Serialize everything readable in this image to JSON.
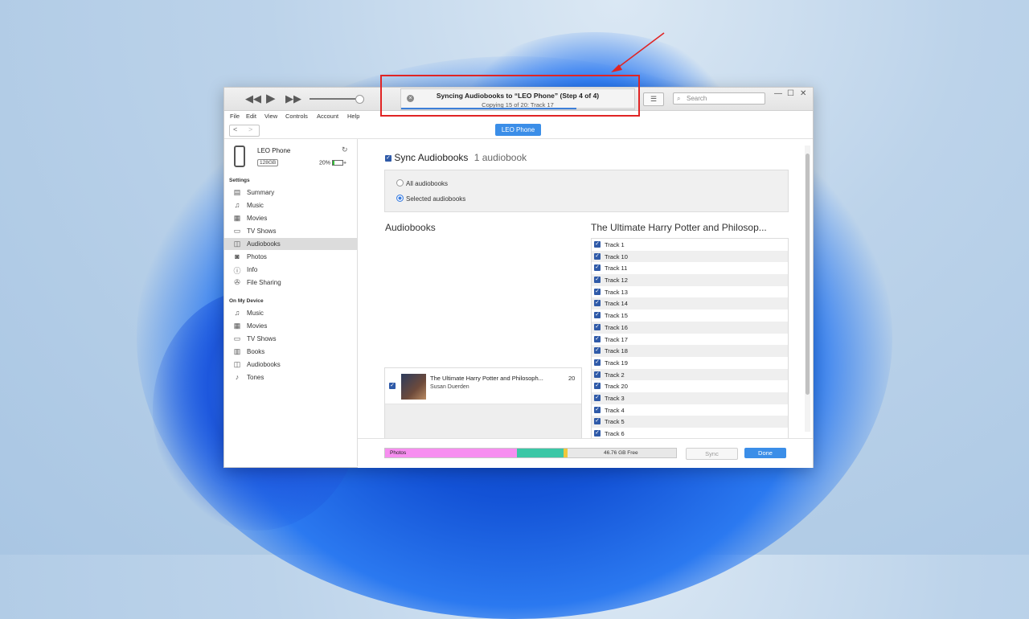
{
  "player": {
    "rewind": "◀◀",
    "play": "▶",
    "forward": "▶▶",
    "volume_level": 0.85
  },
  "status": {
    "title": "Syncing Audiobooks to “LEO Phone” (Step 4 of 4)",
    "subtitle": "Copying 15 of 20: Track 17",
    "progress": 0.75,
    "close_glyph": "×"
  },
  "toolbar": {
    "list_glyph": "☰",
    "search_placeholder": "Search",
    "search_glyph": "⌕"
  },
  "window_controls": {
    "minimize": "—",
    "maximize": "☐",
    "close": "✕"
  },
  "menu": [
    "File",
    "Edit",
    "View",
    "Controls",
    "Account",
    "Help"
  ],
  "nav": {
    "back": "<",
    "forward": ">",
    "device_button": "LEO Phone"
  },
  "device": {
    "name": "LEO Phone",
    "capacity": "128GB",
    "battery": "20%",
    "battery_level": 0.2,
    "plus": "+"
  },
  "sidebar": {
    "settings_header": "Settings",
    "settings": [
      {
        "label": "Summary",
        "icon": "▤"
      },
      {
        "label": "Music",
        "icon": "♫"
      },
      {
        "label": "Movies",
        "icon": "▦"
      },
      {
        "label": "TV Shows",
        "icon": "▭"
      },
      {
        "label": "Audiobooks",
        "icon": "◫",
        "selected": true
      },
      {
        "label": "Photos",
        "icon": "◙"
      },
      {
        "label": "Info",
        "icon": "ⓘ"
      },
      {
        "label": "File Sharing",
        "icon": "✇"
      }
    ],
    "device_header": "On My Device",
    "on_device": [
      {
        "label": "Music",
        "icon": "♫"
      },
      {
        "label": "Movies",
        "icon": "▦"
      },
      {
        "label": "TV Shows",
        "icon": "▭"
      },
      {
        "label": "Books",
        "icon": "▥"
      },
      {
        "label": "Audiobooks",
        "icon": "◫"
      },
      {
        "label": "Tones",
        "icon": "♪"
      }
    ]
  },
  "main": {
    "sync_label": "Sync Audiobooks",
    "sync_count": "1 audiobook",
    "option_all": "All audiobooks",
    "option_selected": "Selected audiobooks",
    "audiobooks_header": "Audiobooks",
    "book": {
      "title": "The Ultimate Harry Potter and Philosoph...",
      "author": "Susan Duerden",
      "count": "20"
    },
    "tracks_header": "The Ultimate Harry Potter and Philosop...",
    "tracks": [
      "Track 1",
      "Track 10",
      "Track 11",
      "Track 12",
      "Track 13",
      "Track 14",
      "Track 15",
      "Track 16",
      "Track 17",
      "Track 18",
      "Track 19",
      "Track 2",
      "Track 20",
      "Track 3",
      "Track 4",
      "Track 5",
      "Track 6"
    ]
  },
  "footer": {
    "photos_label": "Photos",
    "free_label": "46.76 GB Free",
    "sync_button": "Sync",
    "done_button": "Done"
  },
  "colors": {
    "accent": "#3b8ee8",
    "annotation": "#e02424",
    "photos": "#f78ef0",
    "apps": "#3cc7a6"
  }
}
